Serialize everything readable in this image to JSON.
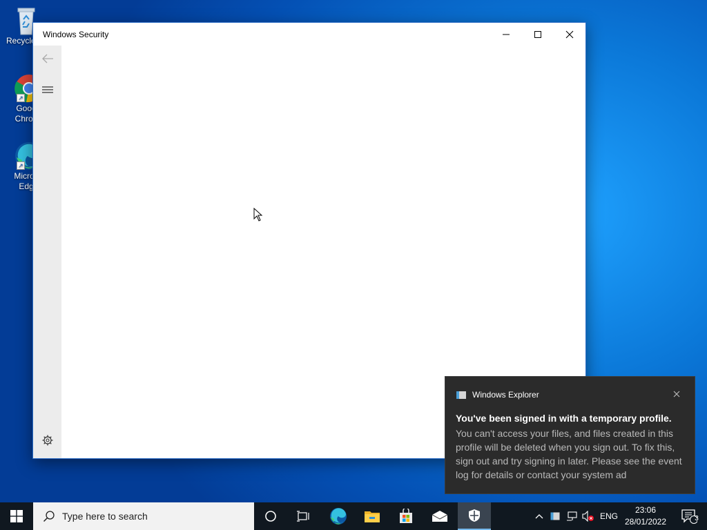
{
  "desktop": {
    "icons": [
      {
        "label": "Recycle"
      },
      {
        "label_line1": "Goog",
        "label_line2": "Chron"
      },
      {
        "label_line1": "Micros",
        "label_line2": "Edg"
      }
    ]
  },
  "window": {
    "title": "Windows Security",
    "controls": {
      "minimize": "minimize-icon",
      "maximize": "maximize-icon",
      "close": "close-icon"
    },
    "sidebar": {
      "back": "back-arrow-icon",
      "menu": "hamburger-menu-icon",
      "settings": "gear-icon"
    }
  },
  "toast": {
    "app_name": "Windows Explorer",
    "headline": "You've been signed in with a temporary profile.",
    "body": "You can't access your files, and files created in this profile will be deleted when you sign out. To fix this, sign out and try signing in later.  Please see the event log for details or contact your system ad"
  },
  "taskbar": {
    "search_placeholder": "Type here to search",
    "language": "ENG",
    "time": "23:06",
    "date": "28/01/2022",
    "notification_count": "3",
    "colors": {
      "accent": "#0078d4",
      "active_bg": "#3a4450"
    }
  }
}
